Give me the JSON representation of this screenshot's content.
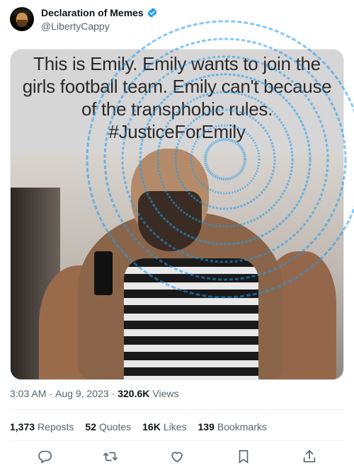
{
  "author": {
    "display_name": "Declaration of Memes",
    "handle": "@LibertyCappy",
    "verified_icon": "verified-badge-icon",
    "verified_color": "#1d9bf0"
  },
  "media": {
    "caption_lines": [
      "This is Emily. Emily wants to join the",
      "girls football team. Emily can't because",
      "of the transphobic rules.",
      "#JusticeForEmily"
    ]
  },
  "meta": {
    "time": "3:03 AM",
    "separator1": "·",
    "date": "Aug 9, 2023",
    "separator2": "·",
    "views_count": "320.6K",
    "views_label": "Views"
  },
  "stats": {
    "reposts": {
      "count": "1,373",
      "label": "Reposts"
    },
    "quotes": {
      "count": "52",
      "label": "Quotes"
    },
    "likes": {
      "count": "16K",
      "label": "Likes"
    },
    "bookmarks": {
      "count": "139",
      "label": "Bookmarks"
    }
  },
  "actions": [
    "reply-icon",
    "repost-icon",
    "like-icon",
    "bookmark-icon",
    "share-icon"
  ],
  "colors": {
    "text_primary": "#0f1419",
    "text_secondary": "#536471",
    "accent": "#1d9bf0"
  }
}
